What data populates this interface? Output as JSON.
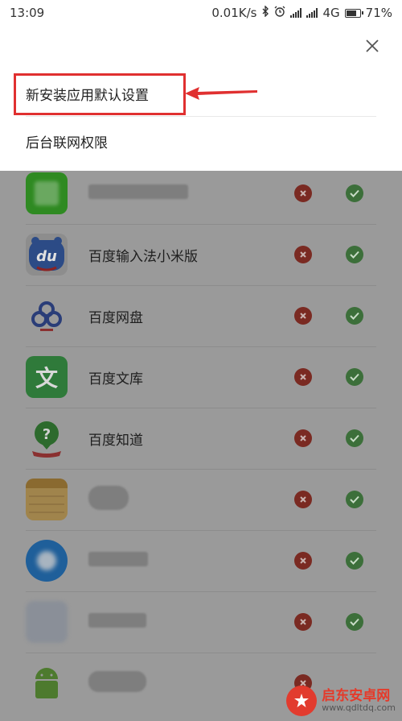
{
  "status_bar": {
    "time": "13:09",
    "speed": "0.01K/s",
    "network": "4G",
    "battery": "71%"
  },
  "popup": {
    "items": [
      {
        "label": "新安装应用默认设置"
      },
      {
        "label": "后台联网权限"
      }
    ]
  },
  "apps": [
    {
      "name": "",
      "icon": "green-app-icon",
      "name_hidden": true
    },
    {
      "name": "百度输入法小米版",
      "icon": "baidu-input-icon"
    },
    {
      "name": "百度网盘",
      "icon": "baidu-netdisk-icon"
    },
    {
      "name": "百度文库",
      "icon": "baidu-wenku-icon"
    },
    {
      "name": "百度知道",
      "icon": "baidu-zhidao-icon"
    },
    {
      "name": "",
      "icon": "notes-app-icon",
      "name_hidden": true
    },
    {
      "name": "",
      "icon": "blue-app-icon",
      "name_hidden": true
    },
    {
      "name": "",
      "icon": "blurred-app-icon",
      "name_hidden": true
    },
    {
      "name": "",
      "icon": "android-icon",
      "name_hidden": true
    }
  ],
  "colors": {
    "deny": "#7a2a22",
    "allow": "#3c6f3a",
    "highlight": "#e03030"
  },
  "watermark": {
    "title": "启东安卓网",
    "url": "www.qdltdq.com"
  }
}
